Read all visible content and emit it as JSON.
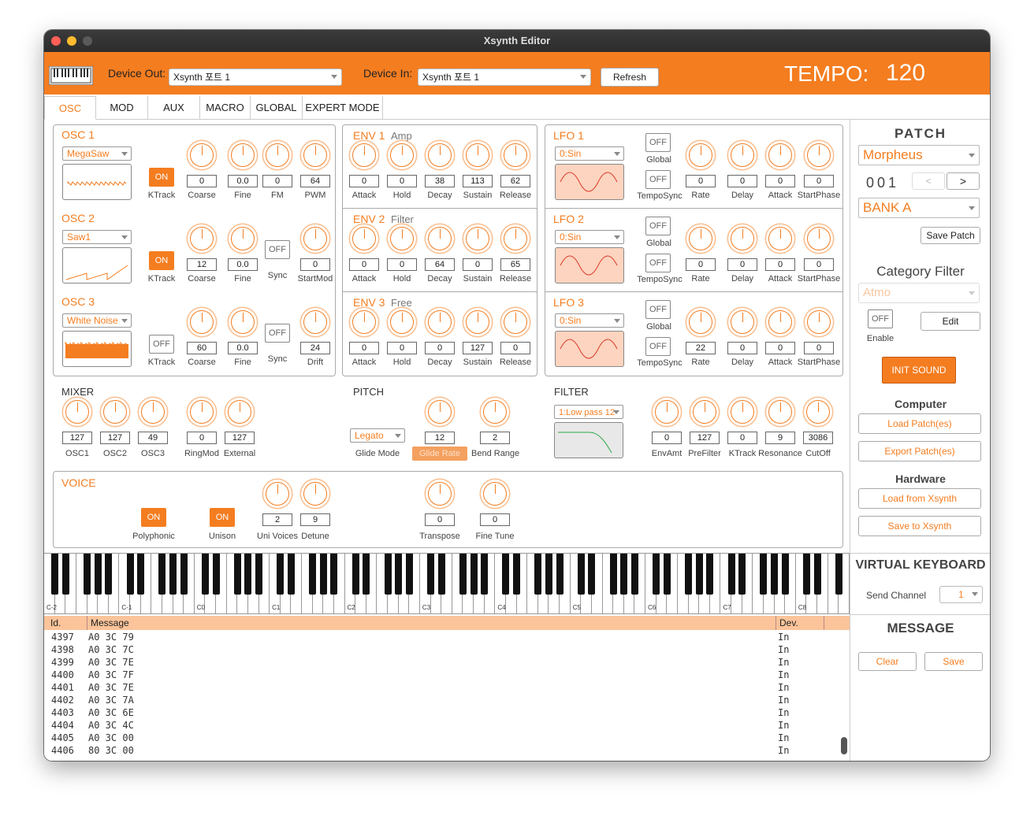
{
  "window": {
    "title": "Xsynth Editor"
  },
  "topbar": {
    "device_out_label": "Device Out:",
    "device_out_value": "Xsynth 포트 1",
    "device_in_label": "Device In:",
    "device_in_value": "Xsynth 포트 1",
    "refresh_label": "Refresh",
    "tempo_label": "TEMPO:",
    "tempo_value": "120"
  },
  "tabs": [
    {
      "label": "OSC",
      "active": true
    },
    {
      "label": "MOD"
    },
    {
      "label": "AUX"
    },
    {
      "label": "MACRO"
    },
    {
      "label": "GLOBAL"
    },
    {
      "label": "EXPERT MODE"
    }
  ],
  "osc": [
    {
      "title": "OSC 1",
      "wave": "MegaSaw",
      "toggle": {
        "state": "ON",
        "label": "KTrack"
      },
      "params": [
        {
          "v": "0",
          "l": "Coarse"
        },
        {
          "v": "0.0",
          "l": "Fine"
        },
        {
          "v": "0",
          "l": "FM"
        },
        {
          "v": "64",
          "l": "PWM"
        }
      ]
    },
    {
      "title": "OSC 2",
      "wave": "Saw1",
      "toggle": {
        "state": "ON",
        "label": "KTrack"
      },
      "params": [
        {
          "v": "12",
          "l": "Coarse"
        },
        {
          "v": "0.0",
          "l": "Fine"
        },
        {
          "v": "OFF",
          "l": "Sync",
          "button": true
        },
        {
          "v": "0",
          "l": "StartMod"
        }
      ]
    },
    {
      "title": "OSC 3",
      "wave": "White Noise",
      "toggle": {
        "state": "OFF",
        "label": "KTrack"
      },
      "params": [
        {
          "v": "60",
          "l": "Coarse"
        },
        {
          "v": "0.0",
          "l": "Fine"
        },
        {
          "v": "OFF",
          "l": "Sync",
          "button": true
        },
        {
          "v": "24",
          "l": "Drift"
        }
      ]
    }
  ],
  "env": [
    {
      "title": "ENV 1",
      "sub": "Amp",
      "params": [
        {
          "v": "0",
          "l": "Attack"
        },
        {
          "v": "0",
          "l": "Hold"
        },
        {
          "v": "38",
          "l": "Decay"
        },
        {
          "v": "113",
          "l": "Sustain"
        },
        {
          "v": "62",
          "l": "Release"
        }
      ]
    },
    {
      "title": "ENV 2",
      "sub": "Filter",
      "params": [
        {
          "v": "0",
          "l": "Attack"
        },
        {
          "v": "0",
          "l": "Hold"
        },
        {
          "v": "64",
          "l": "Decay"
        },
        {
          "v": "0",
          "l": "Sustain"
        },
        {
          "v": "65",
          "l": "Release"
        }
      ]
    },
    {
      "title": "ENV 3",
      "sub": "Free",
      "params": [
        {
          "v": "0",
          "l": "Attack"
        },
        {
          "v": "0",
          "l": "Hold"
        },
        {
          "v": "0",
          "l": "Decay"
        },
        {
          "v": "127",
          "l": "Sustain"
        },
        {
          "v": "0",
          "l": "Release"
        }
      ]
    }
  ],
  "lfo": [
    {
      "title": "LFO 1",
      "wave": "0:Sin",
      "global": "OFF",
      "global_label": "Global",
      "temposync": "OFF",
      "temposync_label": "TempoSync",
      "params": [
        {
          "v": "0",
          "l": "Rate"
        },
        {
          "v": "0",
          "l": "Delay"
        },
        {
          "v": "0",
          "l": "Attack"
        },
        {
          "v": "0",
          "l": "StartPhase"
        }
      ]
    },
    {
      "title": "LFO 2",
      "wave": "0:Sin",
      "global": "OFF",
      "global_label": "Global",
      "temposync": "OFF",
      "temposync_label": "TempoSync",
      "params": [
        {
          "v": "0",
          "l": "Rate"
        },
        {
          "v": "0",
          "l": "Delay"
        },
        {
          "v": "0",
          "l": "Attack"
        },
        {
          "v": "0",
          "l": "StartPhase"
        }
      ]
    },
    {
      "title": "LFO 3",
      "wave": "0:Sin",
      "global": "OFF",
      "global_label": "Global",
      "temposync": "OFF",
      "temposync_label": "TempoSync",
      "params": [
        {
          "v": "22",
          "l": "Rate"
        },
        {
          "v": "0",
          "l": "Delay"
        },
        {
          "v": "0",
          "l": "Attack"
        },
        {
          "v": "0",
          "l": "StartPhase"
        }
      ]
    }
  ],
  "mixer": {
    "title": "MIXER",
    "params": [
      {
        "v": "127",
        "l": "OSC1"
      },
      {
        "v": "127",
        "l": "OSC2"
      },
      {
        "v": "49",
        "l": "OSC3"
      },
      {
        "v": "0",
        "l": "RingMod"
      },
      {
        "v": "127",
        "l": "External"
      }
    ]
  },
  "pitch": {
    "title": "PITCH",
    "glide_mode": "Legato",
    "glide_mode_label": "Glide Mode",
    "glide_rate": "12",
    "glide_rate_label": "Glide Rate",
    "bend_range": "2",
    "bend_range_label": "Bend Range"
  },
  "filter": {
    "title": "FILTER",
    "type": "1:Low pass 12",
    "params": [
      {
        "v": "0",
        "l": "EnvAmt"
      },
      {
        "v": "127",
        "l": "PreFilter"
      },
      {
        "v": "0",
        "l": "KTrack"
      },
      {
        "v": "9",
        "l": "Resonance"
      },
      {
        "v": "3086",
        "l": "CutOff"
      }
    ]
  },
  "voice": {
    "title": "VOICE",
    "polyphonic": "ON",
    "polyphonic_label": "Polyphonic",
    "unison": "ON",
    "unison_label": "Unison",
    "params": [
      {
        "v": "2",
        "l": "Uni Voices"
      },
      {
        "v": "9",
        "l": "Detune"
      }
    ],
    "transpose": "0",
    "transpose_label": "Transpose",
    "finetune": "0",
    "finetune_label": "Fine Tune"
  },
  "patch": {
    "title": "PATCH",
    "name": "Morpheus",
    "number": "001",
    "prev": "<",
    "next": ">",
    "bank": "BANK A",
    "save_label": "Save Patch",
    "category_title": "Category Filter",
    "category_value": "Atmo",
    "enable_state": "OFF",
    "enable_label": "Enable",
    "edit_label": "Edit",
    "init_label": "INIT  SOUND",
    "computer_title": "Computer",
    "load_patches": "Load Patch(es)",
    "export_patches": "Export Patch(es)",
    "hardware_title": "Hardware",
    "load_from": "Load from Xsynth",
    "save_to": "Save to Xsynth"
  },
  "vkeyboard": {
    "title": "VIRTUAL KEYBOARD",
    "send_channel_label": "Send Channel",
    "send_channel": "1",
    "octaves": [
      "C-2",
      "C-1",
      "C0",
      "C1",
      "C2",
      "C3",
      "C4",
      "C5",
      "C6",
      "C7",
      "C8"
    ]
  },
  "message": {
    "title": "MESSAGE",
    "clear": "Clear",
    "save": "Save"
  },
  "log": {
    "headers": {
      "id": "Id.",
      "message": "Message",
      "dev": "Dev."
    },
    "rows": [
      {
        "id": "4397",
        "msg": "A0 3C 79",
        "dev": "In"
      },
      {
        "id": "4398",
        "msg": "A0 3C 7C",
        "dev": "In"
      },
      {
        "id": "4399",
        "msg": "A0 3C 7E",
        "dev": "In"
      },
      {
        "id": "4400",
        "msg": "A0 3C 7F",
        "dev": "In"
      },
      {
        "id": "4401",
        "msg": "A0 3C 7E",
        "dev": "In"
      },
      {
        "id": "4402",
        "msg": "A0 3C 7A",
        "dev": "In"
      },
      {
        "id": "4403",
        "msg": "A0 3C 6E",
        "dev": "In"
      },
      {
        "id": "4404",
        "msg": "A0 3C 4C",
        "dev": "In"
      },
      {
        "id": "4405",
        "msg": "A0 3C 00",
        "dev": "In"
      },
      {
        "id": "4406",
        "msg": "80 3C 00",
        "dev": "In"
      }
    ]
  },
  "colors": {
    "accent": "#f47d20",
    "header": "#fbc49a",
    "lfo_bg": "#fdd4bf"
  }
}
